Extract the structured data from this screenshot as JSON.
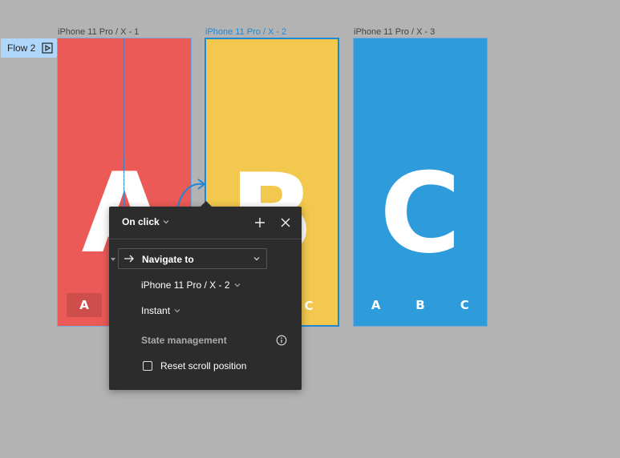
{
  "frames": [
    {
      "label": "iPhone 11 Pro / X - 1",
      "letter": "A",
      "color": "#ec5a57",
      "tabs": [
        "A"
      ]
    },
    {
      "label": "iPhone 11 Pro / X - 2",
      "letter": "B",
      "color": "#f2c84e",
      "tabs": [
        "C"
      ]
    },
    {
      "label": "iPhone 11 Pro / X - 3",
      "letter": "C",
      "color": "#2e9bdb",
      "tabs": [
        "A",
        "B",
        "C"
      ]
    }
  ],
  "flow": {
    "label": "Flow 2",
    "icon": "play-flow-icon"
  },
  "popover": {
    "trigger": "On click",
    "action": "Navigate to",
    "destination": "iPhone 11 Pro / X - 2",
    "animation": "Instant",
    "state_management": "State management",
    "reset_scroll": "Reset scroll position",
    "reset_scroll_checked": false,
    "icons": [
      "chevron-down-icon",
      "plus-icon",
      "close-icon",
      "arrow-right-icon",
      "info-icon"
    ]
  },
  "colors": {
    "canvas": "#b3b3b3",
    "accent": "#1e88d6",
    "panel": "#2c2c2c"
  }
}
